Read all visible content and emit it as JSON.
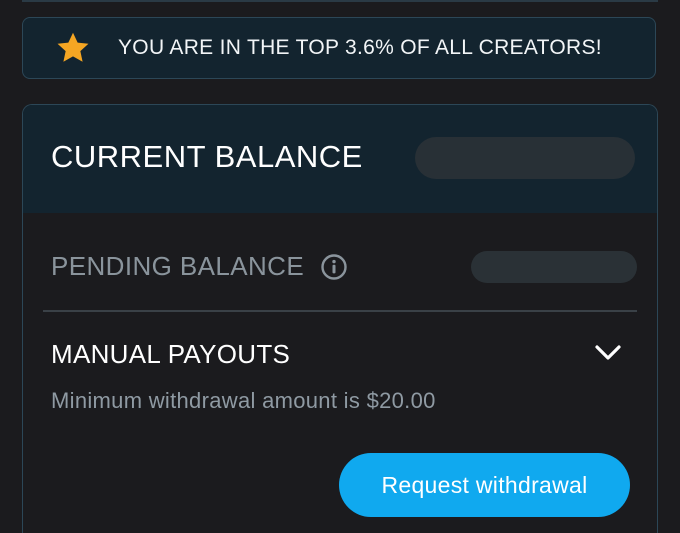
{
  "banner": {
    "icon": "star-icon",
    "text": "YOU ARE IN THE TOP 3.6% OF ALL CREATORS!",
    "star_color": "#f5a623"
  },
  "balance": {
    "current_label": "CURRENT BALANCE",
    "pending_label": "PENDING BALANCE",
    "pending_info_icon": "info-icon"
  },
  "payouts": {
    "title": "MANUAL PAYOUTS",
    "expand_icon": "chevron-down-icon",
    "minimum_text": "Minimum withdrawal amount is $20.00",
    "request_button_label": "Request withdrawal"
  },
  "colors": {
    "background": "#1b1b1e",
    "header_background": "#13242f",
    "accent_button": "#10a9ef",
    "border": "#2c4757"
  }
}
